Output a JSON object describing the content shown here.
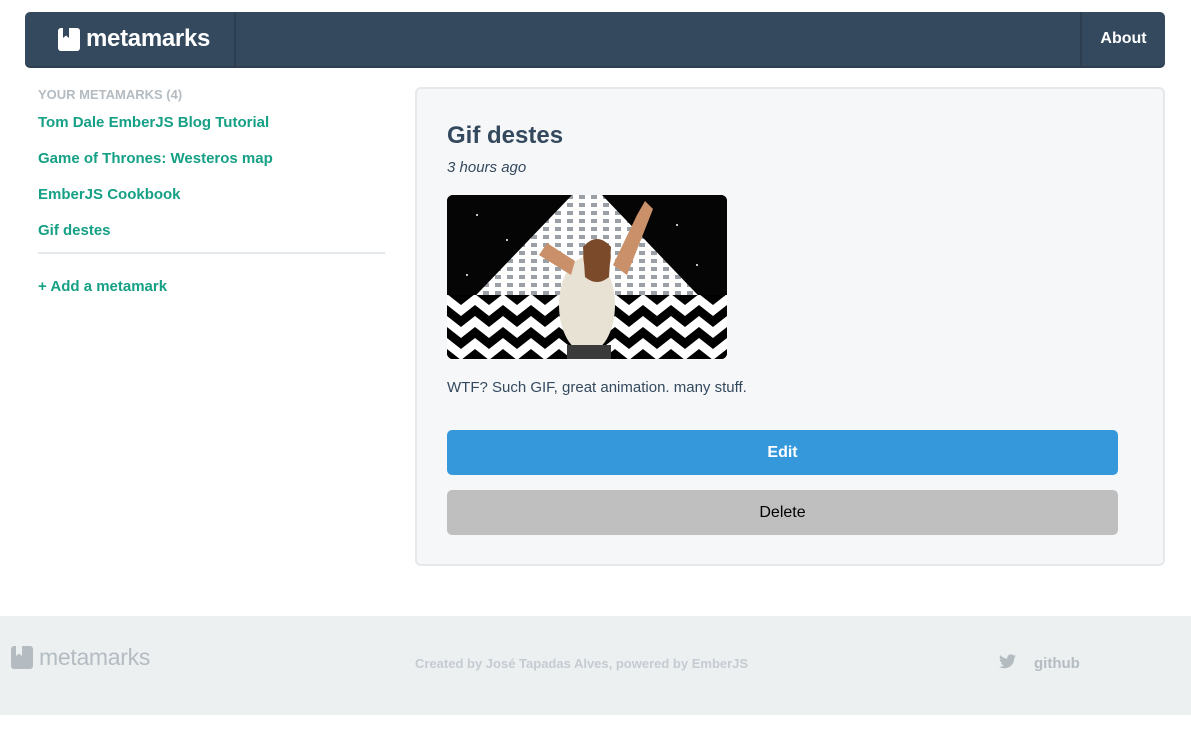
{
  "navbar": {
    "brand": "metamarks",
    "about_label": "About"
  },
  "sidebar": {
    "heading": "YOUR METAMARKS (4)",
    "items": [
      {
        "label": "Tom Dale EmberJS Blog Tutorial"
      },
      {
        "label": "Game of Thrones: Westeros map"
      },
      {
        "label": "EmberJS Cookbook"
      },
      {
        "label": "Gif destes"
      }
    ],
    "add_label": "+ Add a metamark"
  },
  "main": {
    "title": "Gif destes",
    "time": "3 hours ago",
    "description": "WTF? Such GIF, great animation. many stuff.",
    "edit_label": "Edit",
    "delete_label": "Delete"
  },
  "footer": {
    "brand": "metamarks",
    "credits": "Created by José Tapadas Alves, powered by EmberJS",
    "github_label": "github"
  },
  "icons": {
    "brand": "bookmark-icon",
    "twitter": "twitter-icon"
  },
  "colors": {
    "navbar": "#34495e",
    "link": "#16a085",
    "edit_button": "#3498db",
    "delete_button": "#bfbfbf",
    "footer_bg": "#ecf0f1"
  }
}
